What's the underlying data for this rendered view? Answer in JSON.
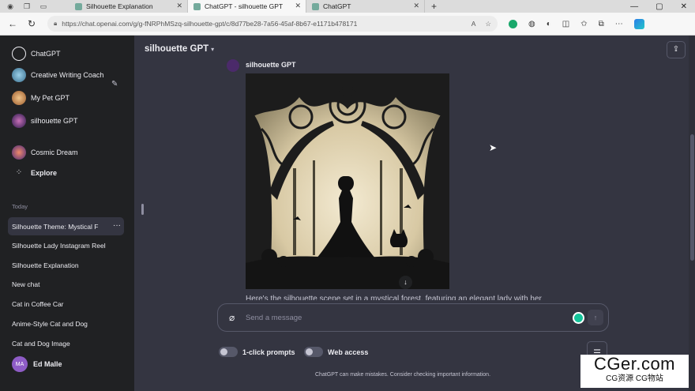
{
  "browser": {
    "tabs": [
      {
        "title": "Silhouette Explanation",
        "active": false
      },
      {
        "title": "ChatGPT - silhouette GPT",
        "active": true
      },
      {
        "title": "ChatGPT",
        "active": false
      }
    ],
    "new_tab": "+",
    "url": "https://chat.openai.com/g/g-fNRPhMSzq-silhouette-gpt/c/8d77be28-7a56-45af-8b67-e1171b478171"
  },
  "sidebar": {
    "gpts": [
      {
        "label": "ChatGPT",
        "icon": "chatgpt-logo-icon",
        "color": "#ffffff"
      },
      {
        "label": "Creative Writing Coach",
        "icon": "writing-coach-avatar",
        "color": "#3a8fb7"
      },
      {
        "label": "My Pet GPT",
        "icon": "pet-gpt-avatar",
        "color": "#c98a4a"
      },
      {
        "label": "silhouette GPT",
        "icon": "silhouette-gpt-avatar",
        "color": "#6a3a8a"
      },
      {
        "label": "Cosmic Dream",
        "icon": "cosmic-dream-avatar",
        "color": "#c0506a"
      },
      {
        "label": "Explore",
        "icon": "explore-icon",
        "color": "#ececf1"
      }
    ],
    "section_today": "Today",
    "history": [
      "Silhouette Theme: Mystical F",
      "Silhouette Lady Instagram Reel",
      "Silhouette Explanation",
      "New chat",
      "Cat in Coffee Car",
      "Anime-Style Cat and Dog",
      "Cat and Dog Image"
    ],
    "user": {
      "initials": "MA",
      "name": "Ed Malle"
    }
  },
  "main": {
    "title": "silhouette GPT",
    "bot_name": "silhouette GPT",
    "reply_text": "Here's the silhouette scene set in a mystical forest, featuring an elegant lady with her",
    "input_placeholder": "Send a message",
    "toggle_1": "1-click prompts",
    "toggle_2": "Web access",
    "disclaimer": "ChatGPT can make mistakes. Consider checking important information."
  },
  "watermark": {
    "line1": "CGer.com",
    "line2": "CG资源 CG物站"
  }
}
